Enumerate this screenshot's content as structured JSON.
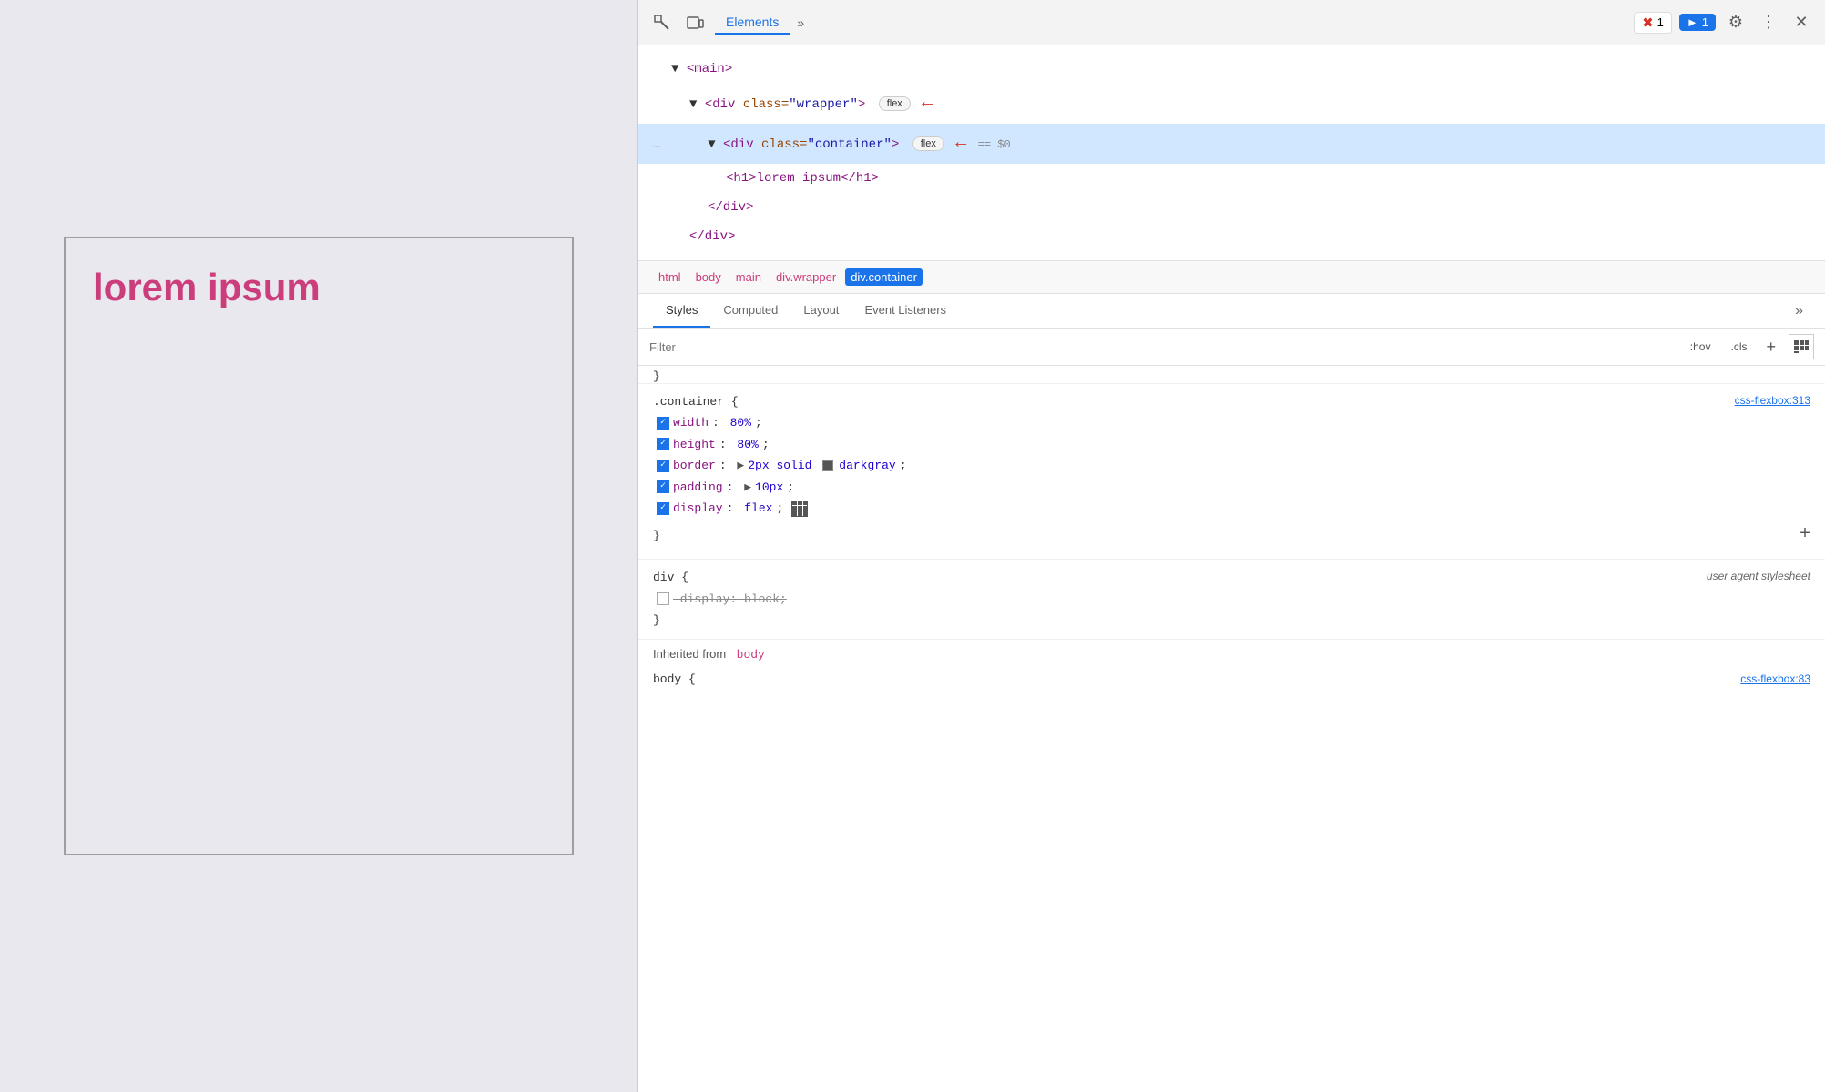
{
  "browser": {
    "lorem_ipsum": "lorem ipsum"
  },
  "devtools": {
    "toolbar": {
      "elements_tab": "Elements",
      "error_count": "1",
      "info_count": "1"
    },
    "dom_tree": {
      "main_tag": "<main>",
      "wrapper_open": "<div class=\"wrapper\">",
      "wrapper_flex_badge": "flex",
      "container_open": "<div class=\"container\">",
      "container_flex_badge": "flex",
      "h1_open": "<h1>lorem ipsum</h1>",
      "div_close": "</div>",
      "div_close2": "</div>"
    },
    "breadcrumb": {
      "items": [
        "html",
        "body",
        "main",
        "div.wrapper",
        "div.container"
      ]
    },
    "tabs": {
      "styles": "Styles",
      "computed": "Computed",
      "layout": "Layout",
      "event_listeners": "Event Listeners"
    },
    "filter": {
      "placeholder": "Filter",
      "hov_btn": ":hov",
      "cls_btn": ".cls"
    },
    "css_rules": [
      {
        "selector": ".container {",
        "source": "css-flexbox:313",
        "properties": [
          {
            "checked": true,
            "name": "width",
            "value": "80%",
            "strikethrough": false
          },
          {
            "checked": true,
            "name": "height",
            "value": "80%",
            "strikethrough": false
          },
          {
            "checked": true,
            "name": "border",
            "value": "2px solid  darkgray;",
            "has_arrow": true,
            "has_color": true,
            "strikethrough": false
          },
          {
            "checked": true,
            "name": "padding",
            "value": "10px;",
            "has_arrow": true,
            "strikethrough": false
          },
          {
            "checked": true,
            "name": "display",
            "value": "flex;",
            "has_flex_icon": true,
            "strikethrough": false
          }
        ],
        "close": "}"
      },
      {
        "selector": "div {",
        "source": "user agent stylesheet",
        "properties": [
          {
            "checked": false,
            "name": "display",
            "value": "block;",
            "strikethrough": true
          }
        ],
        "close": "}"
      }
    ],
    "inherited": {
      "label": "Inherited from",
      "tag": "body"
    },
    "body_rule": {
      "partial": "body {",
      "source": "css-flexbox:83"
    }
  }
}
